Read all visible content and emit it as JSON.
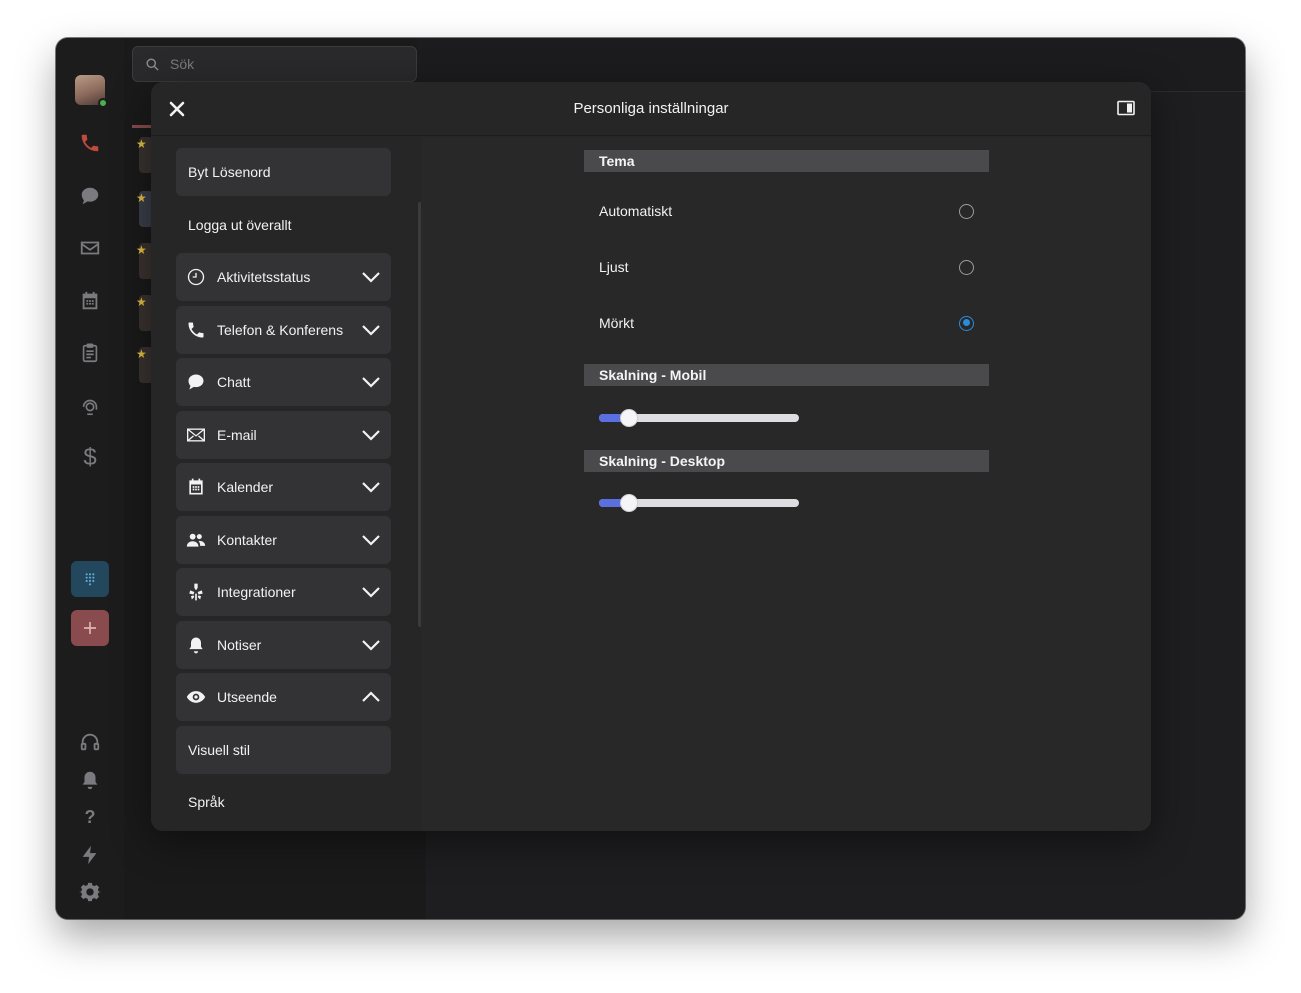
{
  "window": {
    "search": {
      "placeholder": "Sök"
    }
  },
  "modal": {
    "title": "Personliga inställningar",
    "menu": {
      "change_password": "Byt Lösenord",
      "logout_everywhere": "Logga ut överallt",
      "sections": [
        {
          "label": "Aktivitetsstatus",
          "icon": "clock-icon",
          "expanded": false
        },
        {
          "label": "Telefon & Konferens",
          "icon": "phone-icon",
          "expanded": false
        },
        {
          "label": "Chatt",
          "icon": "chat-icon",
          "expanded": false
        },
        {
          "label": "E-mail",
          "icon": "mail-icon",
          "expanded": false
        },
        {
          "label": "Kalender",
          "icon": "calendar-icon",
          "expanded": false
        },
        {
          "label": "Kontakter",
          "icon": "contacts-icon",
          "expanded": false
        },
        {
          "label": "Integrationer",
          "icon": "integrations-icon",
          "expanded": false
        },
        {
          "label": "Notiser",
          "icon": "bell-icon",
          "expanded": false
        },
        {
          "label": "Utseende",
          "icon": "eye-icon",
          "expanded": true
        }
      ],
      "sub_items": {
        "visual_style": "Visuell stil",
        "language": "Språk"
      }
    },
    "content": {
      "theme": {
        "header": "Tema",
        "options": [
          {
            "label": "Automatiskt",
            "selected": false
          },
          {
            "label": "Ljust",
            "selected": false
          },
          {
            "label": "Mörkt",
            "selected": true
          }
        ]
      },
      "scaling_mobile": {
        "header": "Skalning - Mobil",
        "value_fraction": 0.15
      },
      "scaling_desktop": {
        "header": "Skalning - Desktop",
        "value_fraction": 0.15
      }
    }
  },
  "colors": {
    "accent": "#2d8cd8",
    "slider_fill": "#5a6fe0",
    "keypad_button": "#23485e",
    "add_button": "#8a4b4f"
  }
}
